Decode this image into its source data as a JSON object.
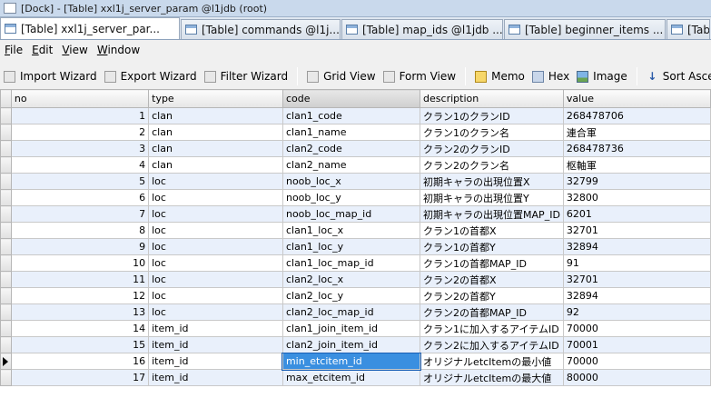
{
  "window": {
    "title": "[Dock] - [Table] xxl1j_server_param @l1jdb (root)"
  },
  "tabs": [
    {
      "label": "[Table] xxl1j_server_par...",
      "active": true
    },
    {
      "label": "[Table] commands @l1j...",
      "active": false
    },
    {
      "label": "[Table] map_ids @l1jdb ...",
      "active": false
    },
    {
      "label": "[Table] beginner_items ...",
      "active": false
    },
    {
      "label": "[Table]",
      "active": false
    }
  ],
  "menu": [
    {
      "key": "F",
      "rest": "ile"
    },
    {
      "key": "E",
      "rest": "dit"
    },
    {
      "key": "V",
      "rest": "iew"
    },
    {
      "key": "W",
      "rest": "indow"
    }
  ],
  "toolbar": {
    "import_wizard": "Import Wizard",
    "export_wizard": "Export Wizard",
    "filter_wizard": "Filter Wizard",
    "grid_view": "Grid View",
    "form_view": "Form View",
    "memo": "Memo",
    "hex": "Hex",
    "image": "Image",
    "sort_ascending": "Sort Ascending"
  },
  "grid": {
    "columns": [
      "no",
      "type",
      "code",
      "description",
      "value"
    ],
    "rows": [
      [
        "1",
        "clan",
        "clan1_code",
        "クラン1のクランID",
        "268478706"
      ],
      [
        "2",
        "clan",
        "clan1_name",
        "クラン1のクラン名",
        "連合軍"
      ],
      [
        "3",
        "clan",
        "clan2_code",
        "クラン2のクランID",
        "268478736"
      ],
      [
        "4",
        "clan",
        "clan2_name",
        "クラン2のクラン名",
        "枢軸軍"
      ],
      [
        "5",
        "loc",
        "noob_loc_x",
        "初期キャラの出現位置X",
        "32799"
      ],
      [
        "6",
        "loc",
        "noob_loc_y",
        "初期キャラの出現位置Y",
        "32800"
      ],
      [
        "7",
        "loc",
        "noob_loc_map_id",
        "初期キャラの出現位置MAP_ID",
        "6201"
      ],
      [
        "8",
        "loc",
        "clan1_loc_x",
        "クラン1の首都X",
        "32701"
      ],
      [
        "9",
        "loc",
        "clan1_loc_y",
        "クラン1の首都Y",
        "32894"
      ],
      [
        "10",
        "loc",
        "clan1_loc_map_id",
        "クラン1の首都MAP_ID",
        "91"
      ],
      [
        "11",
        "loc",
        "clan2_loc_x",
        "クラン2の首都X",
        "32701"
      ],
      [
        "12",
        "loc",
        "clan2_loc_y",
        "クラン2の首都Y",
        "32894"
      ],
      [
        "13",
        "loc",
        "clan2_loc_map_id",
        "クラン2の首都MAP_ID",
        "92"
      ],
      [
        "14",
        "item_id",
        "clan1_join_item_id",
        "クラン1に加入するアイテムID",
        "70000"
      ],
      [
        "15",
        "item_id",
        "clan2_join_item_id",
        "クラン2に加入するアイテムID",
        "70001"
      ],
      [
        "16",
        "item_id",
        "min_etcitem_id",
        "オリジナルetcItemの最小値",
        "70000"
      ],
      [
        "17",
        "item_id",
        "max_etcitem_id",
        "オリジナルetcItemの最大値",
        "80000"
      ]
    ]
  },
  "colors": {
    "row_alt": "#e9f0fb",
    "selection": "#3a8fe0",
    "titlebar": "#c9d9ec"
  },
  "icons": {
    "title": "app-window-icon",
    "tab": "table-icon",
    "memo": "memo-icon",
    "hex": "hex-icon",
    "image": "image-icon",
    "sort": "sort-ascending-icon"
  }
}
